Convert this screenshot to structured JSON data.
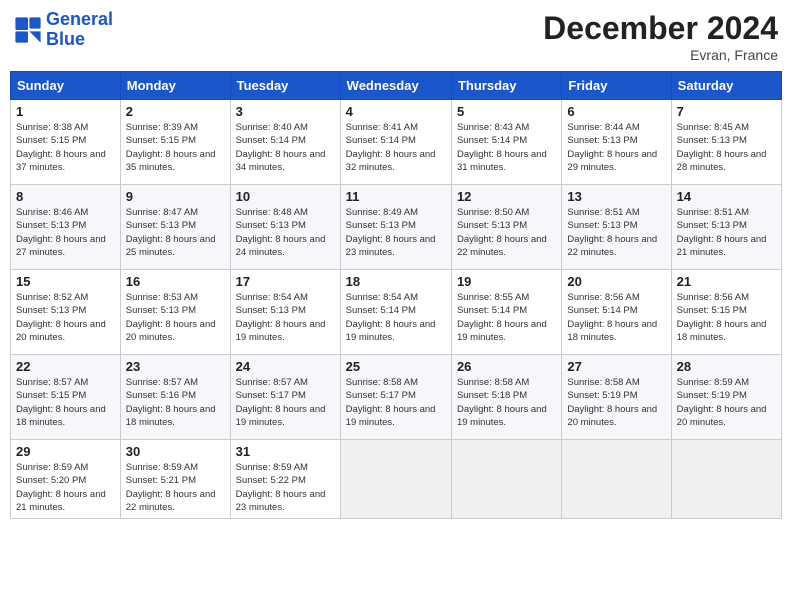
{
  "header": {
    "logo_line1": "General",
    "logo_line2": "Blue",
    "month": "December 2024",
    "location": "Evran, France"
  },
  "days": [
    "Sunday",
    "Monday",
    "Tuesday",
    "Wednesday",
    "Thursday",
    "Friday",
    "Saturday"
  ],
  "weeks": [
    [
      {
        "day": 1,
        "sunrise": "8:38 AM",
        "sunset": "5:15 PM",
        "daylight": "8 hours and 37 minutes."
      },
      {
        "day": 2,
        "sunrise": "8:39 AM",
        "sunset": "5:15 PM",
        "daylight": "8 hours and 35 minutes."
      },
      {
        "day": 3,
        "sunrise": "8:40 AM",
        "sunset": "5:14 PM",
        "daylight": "8 hours and 34 minutes."
      },
      {
        "day": 4,
        "sunrise": "8:41 AM",
        "sunset": "5:14 PM",
        "daylight": "8 hours and 32 minutes."
      },
      {
        "day": 5,
        "sunrise": "8:43 AM",
        "sunset": "5:14 PM",
        "daylight": "8 hours and 31 minutes."
      },
      {
        "day": 6,
        "sunrise": "8:44 AM",
        "sunset": "5:13 PM",
        "daylight": "8 hours and 29 minutes."
      },
      {
        "day": 7,
        "sunrise": "8:45 AM",
        "sunset": "5:13 PM",
        "daylight": "8 hours and 28 minutes."
      }
    ],
    [
      {
        "day": 8,
        "sunrise": "8:46 AM",
        "sunset": "5:13 PM",
        "daylight": "8 hours and 27 minutes."
      },
      {
        "day": 9,
        "sunrise": "8:47 AM",
        "sunset": "5:13 PM",
        "daylight": "8 hours and 25 minutes."
      },
      {
        "day": 10,
        "sunrise": "8:48 AM",
        "sunset": "5:13 PM",
        "daylight": "8 hours and 24 minutes."
      },
      {
        "day": 11,
        "sunrise": "8:49 AM",
        "sunset": "5:13 PM",
        "daylight": "8 hours and 23 minutes."
      },
      {
        "day": 12,
        "sunrise": "8:50 AM",
        "sunset": "5:13 PM",
        "daylight": "8 hours and 22 minutes."
      },
      {
        "day": 13,
        "sunrise": "8:51 AM",
        "sunset": "5:13 PM",
        "daylight": "8 hours and 22 minutes."
      },
      {
        "day": 14,
        "sunrise": "8:51 AM",
        "sunset": "5:13 PM",
        "daylight": "8 hours and 21 minutes."
      }
    ],
    [
      {
        "day": 15,
        "sunrise": "8:52 AM",
        "sunset": "5:13 PM",
        "daylight": "8 hours and 20 minutes."
      },
      {
        "day": 16,
        "sunrise": "8:53 AM",
        "sunset": "5:13 PM",
        "daylight": "8 hours and 20 minutes."
      },
      {
        "day": 17,
        "sunrise": "8:54 AM",
        "sunset": "5:13 PM",
        "daylight": "8 hours and 19 minutes."
      },
      {
        "day": 18,
        "sunrise": "8:54 AM",
        "sunset": "5:14 PM",
        "daylight": "8 hours and 19 minutes."
      },
      {
        "day": 19,
        "sunrise": "8:55 AM",
        "sunset": "5:14 PM",
        "daylight": "8 hours and 19 minutes."
      },
      {
        "day": 20,
        "sunrise": "8:56 AM",
        "sunset": "5:14 PM",
        "daylight": "8 hours and 18 minutes."
      },
      {
        "day": 21,
        "sunrise": "8:56 AM",
        "sunset": "5:15 PM",
        "daylight": "8 hours and 18 minutes."
      }
    ],
    [
      {
        "day": 22,
        "sunrise": "8:57 AM",
        "sunset": "5:15 PM",
        "daylight": "8 hours and 18 minutes."
      },
      {
        "day": 23,
        "sunrise": "8:57 AM",
        "sunset": "5:16 PM",
        "daylight": "8 hours and 18 minutes."
      },
      {
        "day": 24,
        "sunrise": "8:57 AM",
        "sunset": "5:17 PM",
        "daylight": "8 hours and 19 minutes."
      },
      {
        "day": 25,
        "sunrise": "8:58 AM",
        "sunset": "5:17 PM",
        "daylight": "8 hours and 19 minutes."
      },
      {
        "day": 26,
        "sunrise": "8:58 AM",
        "sunset": "5:18 PM",
        "daylight": "8 hours and 19 minutes."
      },
      {
        "day": 27,
        "sunrise": "8:58 AM",
        "sunset": "5:19 PM",
        "daylight": "8 hours and 20 minutes."
      },
      {
        "day": 28,
        "sunrise": "8:59 AM",
        "sunset": "5:19 PM",
        "daylight": "8 hours and 20 minutes."
      }
    ],
    [
      {
        "day": 29,
        "sunrise": "8:59 AM",
        "sunset": "5:20 PM",
        "daylight": "8 hours and 21 minutes."
      },
      {
        "day": 30,
        "sunrise": "8:59 AM",
        "sunset": "5:21 PM",
        "daylight": "8 hours and 22 minutes."
      },
      {
        "day": 31,
        "sunrise": "8:59 AM",
        "sunset": "5:22 PM",
        "daylight": "8 hours and 23 minutes."
      },
      null,
      null,
      null,
      null
    ]
  ]
}
